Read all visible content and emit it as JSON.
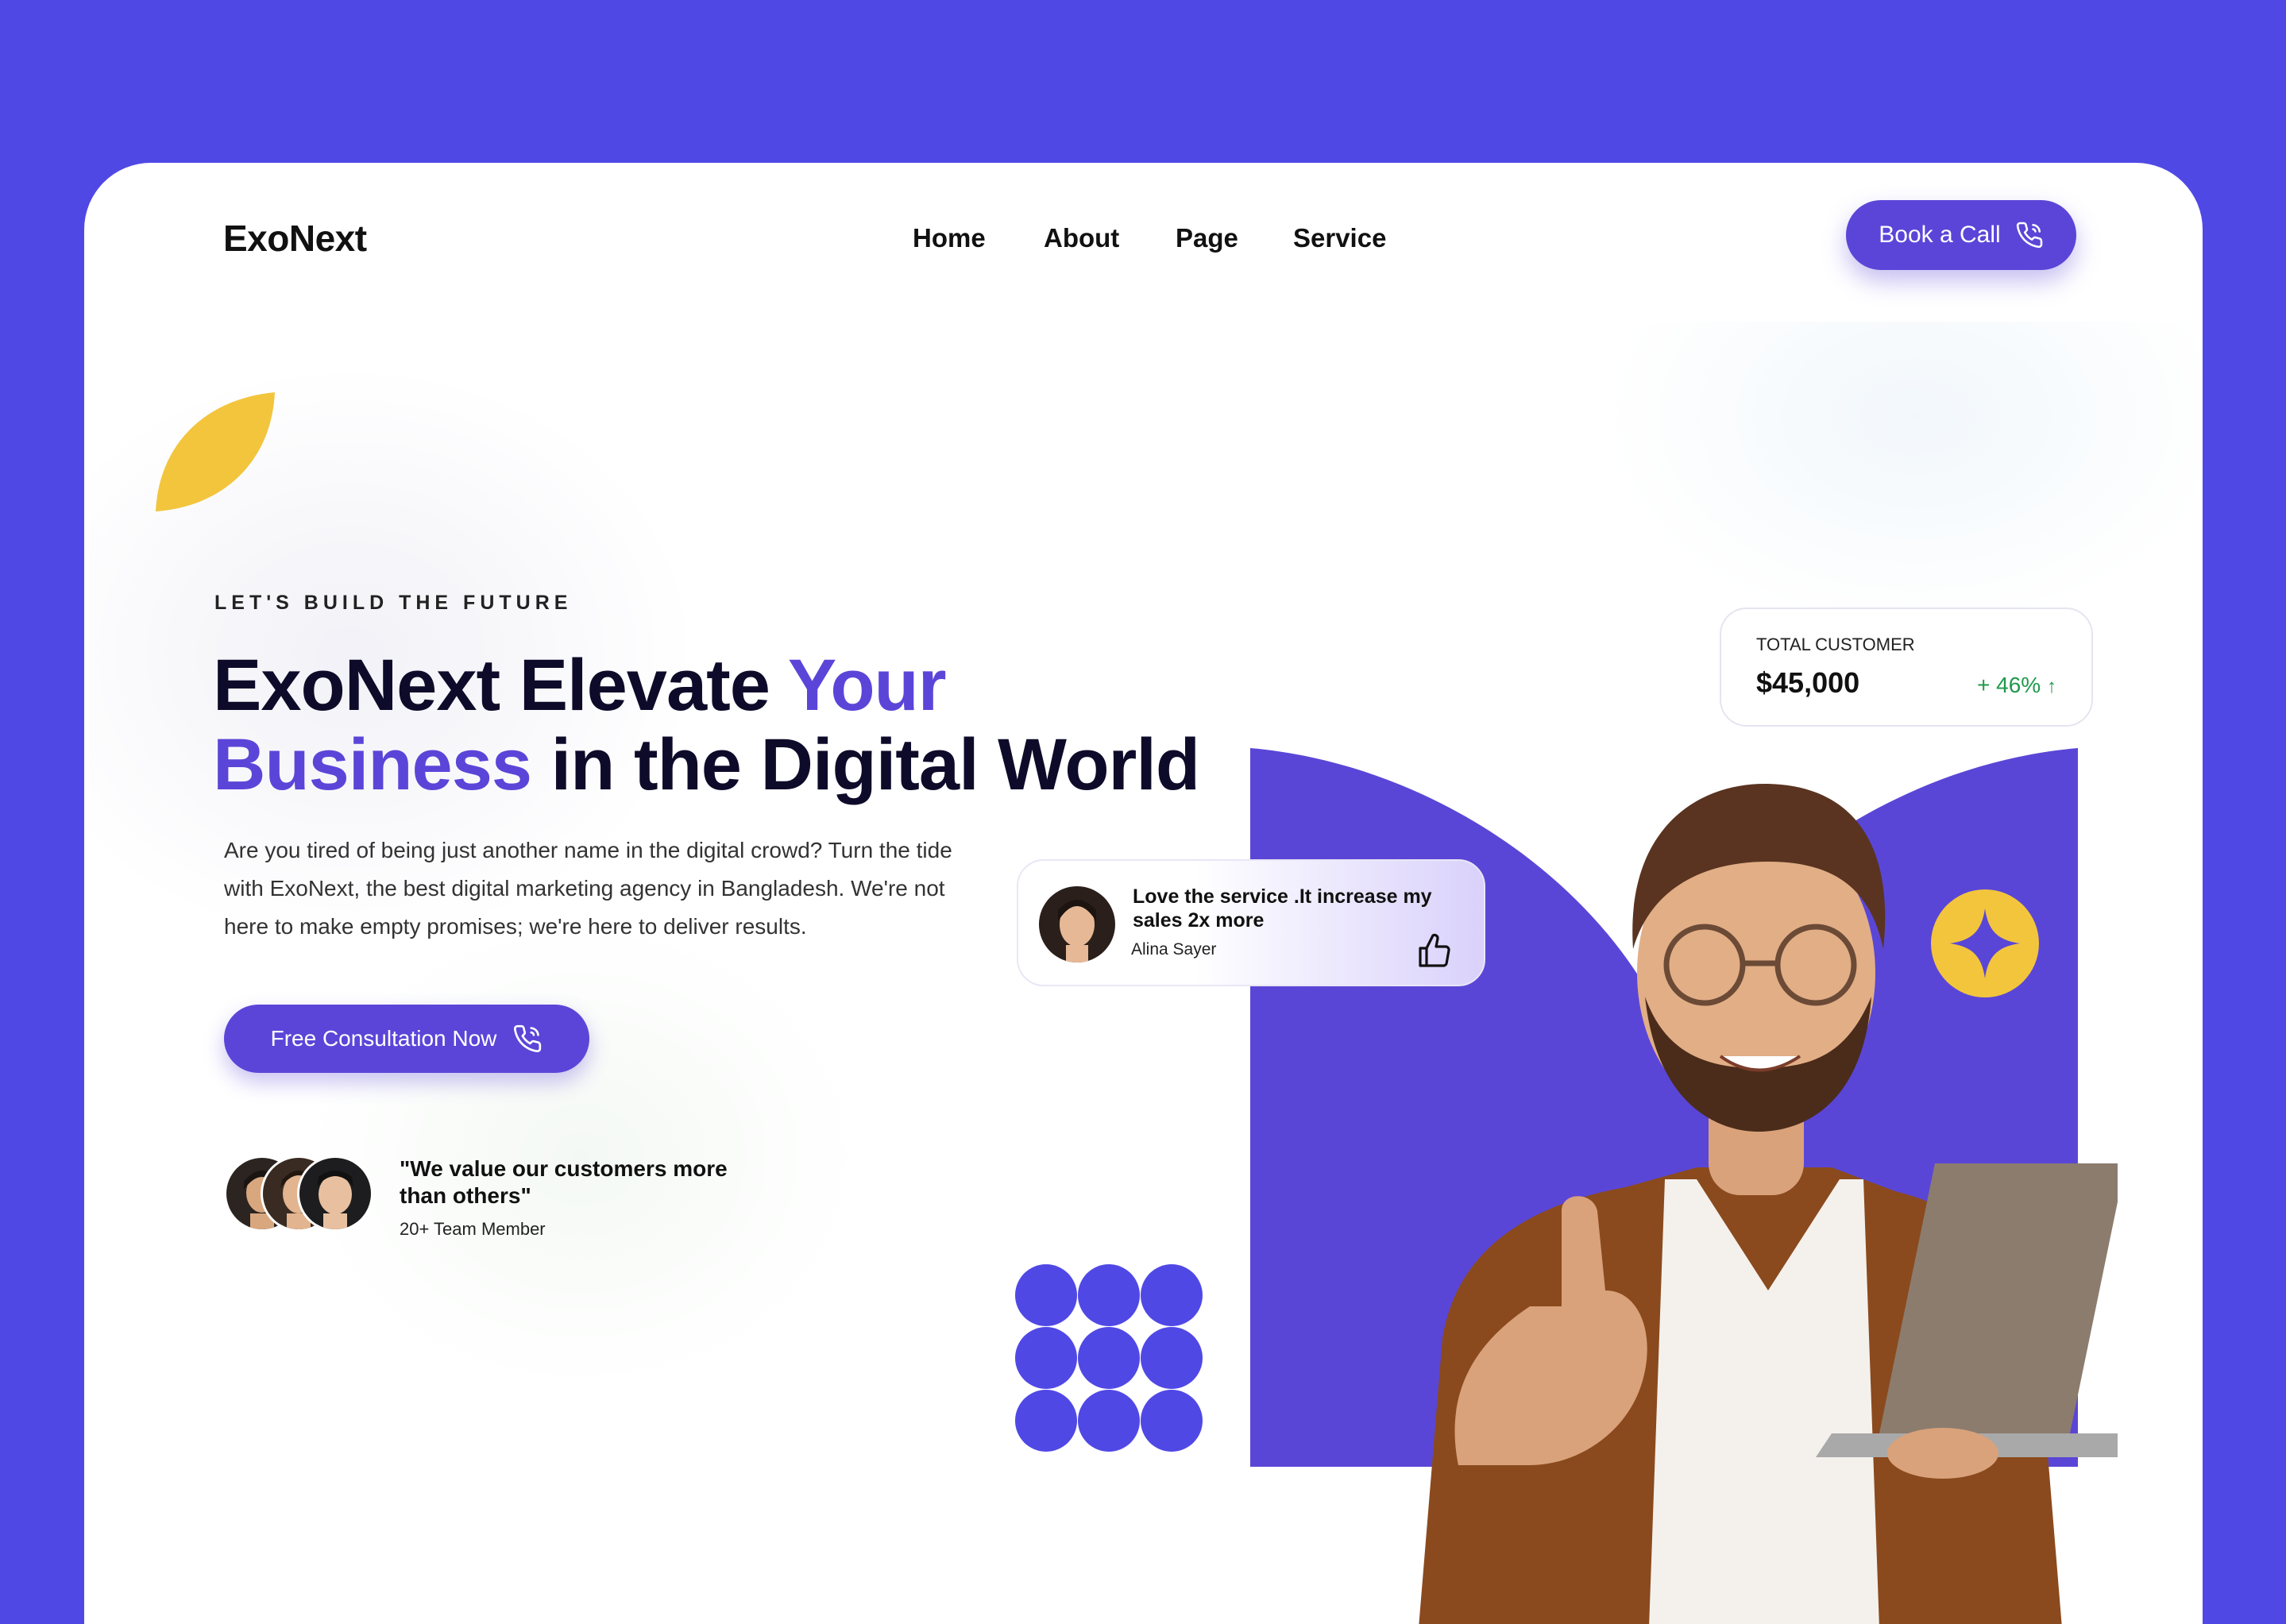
{
  "brand": {
    "name": "ExoNext"
  },
  "nav": {
    "items": [
      {
        "label": "Home"
      },
      {
        "label": "About"
      },
      {
        "label": "Page"
      },
      {
        "label": "Service"
      }
    ],
    "cta_label": "Book a Call"
  },
  "hero": {
    "eyebrow": "LET'S BUILD THE FUTURE",
    "headline": {
      "part1": "ExoNext Elevate ",
      "part2": "Your",
      "part3": "Business",
      "part4": " in the Digital World"
    },
    "description": "Are you tired of being just another name in the digital crowd? Turn the tide with ExoNext, the best digital marketing agency in Bangladesh. We're not here to make empty promises; we're here to deliver results.",
    "cta_label": "Free Consultation Now",
    "quote": "\"We value our customers more than others\"",
    "team_count": "20+ Team Member"
  },
  "review": {
    "text": "Love the service .It increase my sales 2x more",
    "author": "Alina Sayer"
  },
  "stat": {
    "label": "TOTAL CUSTOMER",
    "value": "$45,000",
    "change": "+ 46%",
    "trend": "↑"
  },
  "colors": {
    "background": "#5048E5",
    "accent": "#5B45D8",
    "leaf": "#F2C53D",
    "positive": "#1E9A4B"
  },
  "icons": [
    "phone-icon",
    "thumbs-up-icon",
    "sparkle-star-icon",
    "leaf-decoration",
    "arrow-up-icon"
  ]
}
